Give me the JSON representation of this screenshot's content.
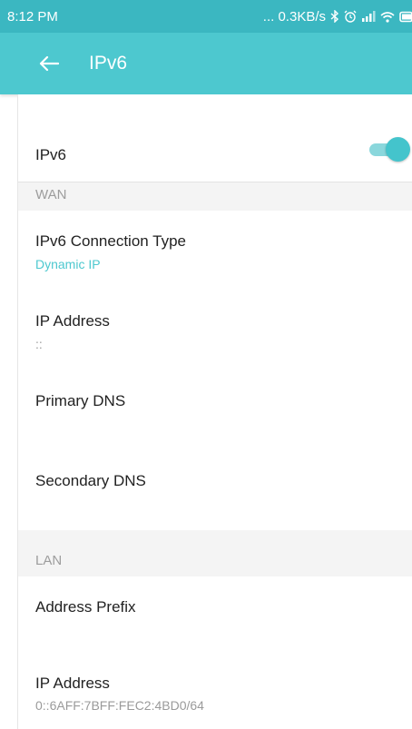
{
  "status_bar": {
    "time": "8:12 PM",
    "network_speed": "... 0.3KB/s",
    "icons": [
      "bluetooth-icon",
      "alarm-icon",
      "signal-icon",
      "wifi-icon",
      "battery-icon"
    ]
  },
  "header": {
    "title": "IPv6",
    "back_icon": "arrow-left-icon",
    "color": "#4dc8cf"
  },
  "ipv6_toggle": {
    "label": "IPv6",
    "enabled": true,
    "accent": "#44c4cc"
  },
  "wan": {
    "section_label": "WAN",
    "connection_type_label": "IPv6 Connection Type",
    "connection_type_value": "Dynamic IP",
    "ip_address_label": "IP Address",
    "ip_address_value": "::",
    "primary_dns_label": "Primary DNS",
    "secondary_dns_label": "Secondary DNS"
  },
  "lan": {
    "section_label": "LAN",
    "address_prefix_label": "Address Prefix",
    "ip_address_label": "IP Address",
    "ip_address_value": "0::6AFF:7BFF:FEC2:4BD0/64"
  }
}
